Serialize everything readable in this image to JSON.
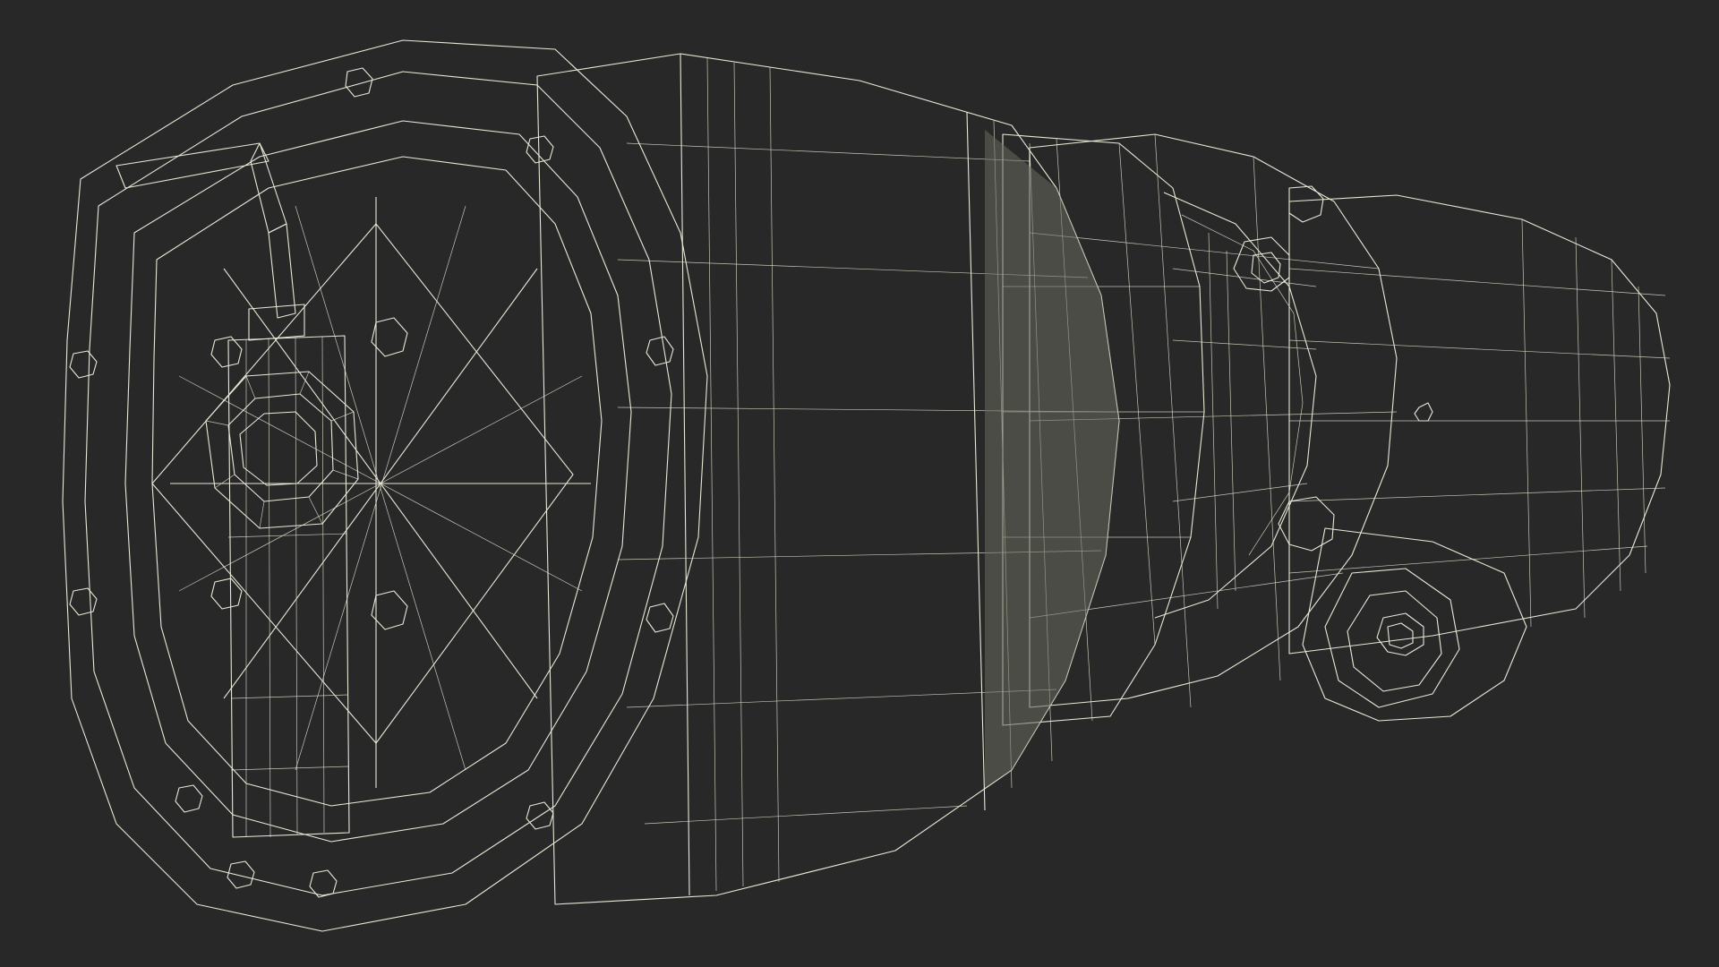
{
  "viewport": {
    "background": "#282828",
    "surface_color": "#7a7a70",
    "wire_color": "#e9e8d6"
  },
  "model": {
    "parts": [
      "front-end-cap",
      "terminal-box",
      "center-hex-nut",
      "motor-housing",
      "clamp-band",
      "rear-bearing-housing",
      "mount-lug",
      "rear-cylinder"
    ]
  }
}
